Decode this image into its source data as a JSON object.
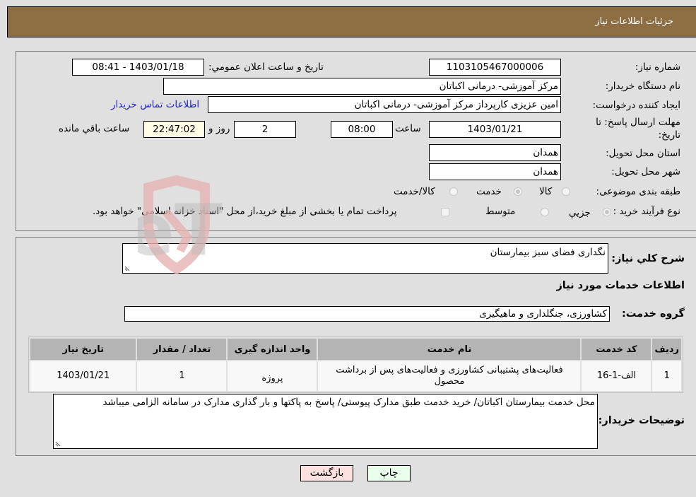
{
  "header": {
    "title": "جزئیات اطلاعات نیاز"
  },
  "form": {
    "need_number": {
      "label": "شماره نیاز:",
      "value": "1103105467000006"
    },
    "announce_datetime": {
      "label": "تاریخ و ساعت اعلان عمومي:",
      "value": "1403/01/18 - 08:41"
    },
    "buyer_org": {
      "label": "نام دستگاه خریدار:",
      "value": "مرکز آموزشی- درمانی اکباتان"
    },
    "requester": {
      "label": "ایجاد کننده درخواست:",
      "value": "امین عزیزی کارپرداز مرکز آموزشی- درمانی اکباتان"
    },
    "buyer_contact_link": "اطلاعات تماس خریدار",
    "deadline": {
      "label_line1": "مهلت ارسال پاسخ: تا",
      "label_line2": "تاریخ:",
      "date": "1403/01/21",
      "time_label": "ساعت",
      "time": "08:00",
      "days": "2",
      "days_label": "روز و",
      "remaining": "22:47:02",
      "remaining_label": "ساعت باقي مانده"
    },
    "province": {
      "label": "استان محل تحویل:",
      "value": "همدان"
    },
    "city": {
      "label": "شهر محل تحویل:",
      "value": "همدان"
    },
    "category": {
      "label": "طبقه بندی موضوعی:",
      "options": [
        "کالا",
        "خدمت",
        "کالا/خدمت"
      ],
      "selected": "خدمت"
    },
    "purchase_type": {
      "label": "نوع فرآیند خرید :",
      "options": [
        "جزيي",
        "متوسط"
      ],
      "selected": "جزيي",
      "treasury_note": "پرداخت تمام یا بخشی از مبلغ خرید،از محل \"اسناد خزانه اسلامی\" خواهد بود.",
      "treasury_checked": false
    }
  },
  "details": {
    "description_label": "شرح کلي نیاز:",
    "description": "نگداری فضای سبز بیمارستان",
    "services_heading": "اطلاعات خدمات مورد نیاز",
    "service_group_label": "گروه خدمت:",
    "service_group": "کشاورزی، جنگلداری و ماهیگیری",
    "table": {
      "columns": [
        "ردیف",
        "کد خدمت",
        "نام خدمت",
        "واحد اندازه گیری",
        "تعداد / مقدار",
        "تاریخ نیاز"
      ],
      "rows": [
        [
          "1",
          "الف-1-16",
          "فعالیت‌های پشتیبانی کشاورزی و فعالیت‌های پس از برداشت محصول",
          "پروژه",
          "1",
          "1403/01/21"
        ]
      ]
    },
    "buyer_notes_label": "توضیحات خریدار:",
    "buyer_notes": "محل خدمت بیمارستان اکباتان/ خرید خدمت طبق مدارک پیوستی/ پاسخ به پاکتها و بار گذاری مدارک در سامانه الزامی میباشد"
  },
  "buttons": {
    "print": "چاپ",
    "back": "بازگشت"
  },
  "colors": {
    "header_bg": "#8d6d42",
    "print_bg": "#eaffea",
    "back_bg": "#ffe0e0",
    "link": "#2222cc"
  },
  "watermark": {
    "text": "AriaTender.neT"
  }
}
